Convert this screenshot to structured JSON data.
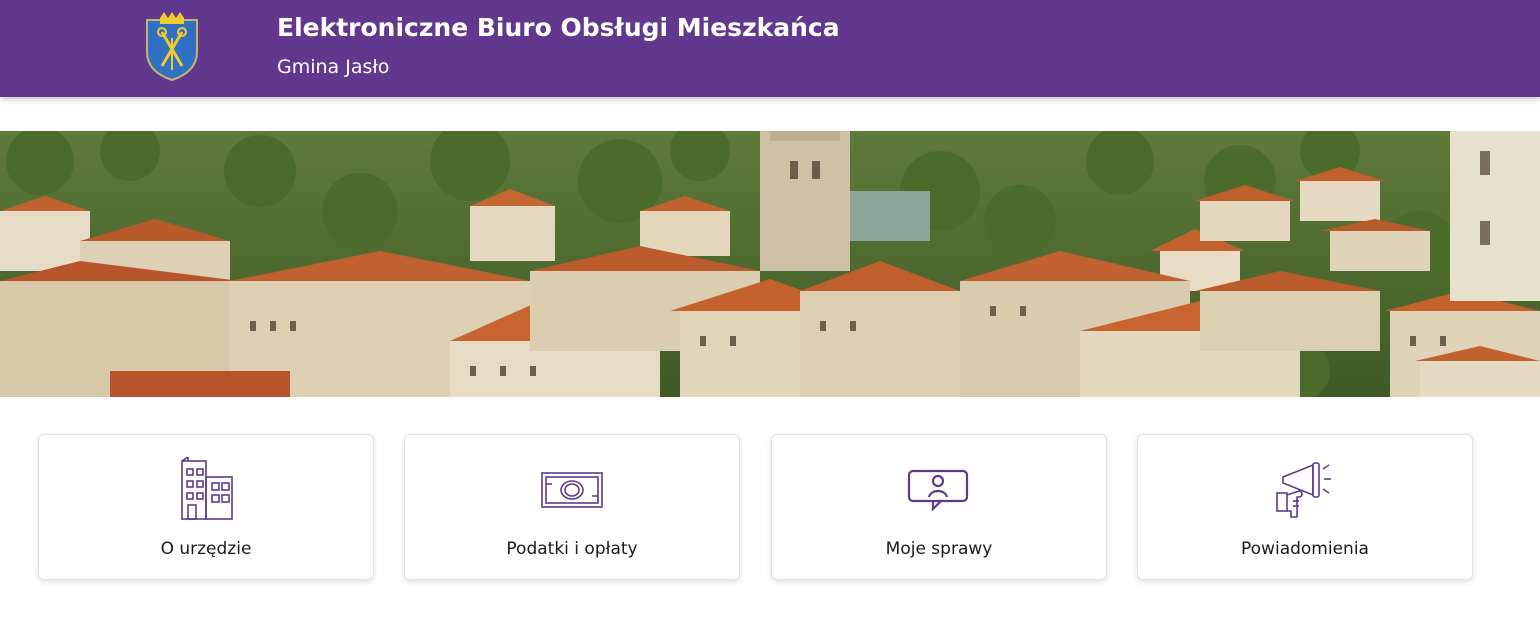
{
  "header": {
    "title": "Elektroniczne Biuro Obsługi Mieszkańca",
    "subtitle": "Gmina Jasło",
    "background_color": "#62388f",
    "crest_icon": "coat-of-arms-icon"
  },
  "hero": {
    "image": "town-aerial-photo"
  },
  "tiles": [
    {
      "label": "O urzędzie",
      "icon": "building-icon"
    },
    {
      "label": "Podatki i opłaty",
      "icon": "banknote-icon"
    },
    {
      "label": "Moje sprawy",
      "icon": "user-chat-icon"
    },
    {
      "label": "Powiadomienia",
      "icon": "megaphone-icon"
    }
  ],
  "colors": {
    "accent": "#62388f",
    "icon_stroke": "#5e3a8a"
  }
}
